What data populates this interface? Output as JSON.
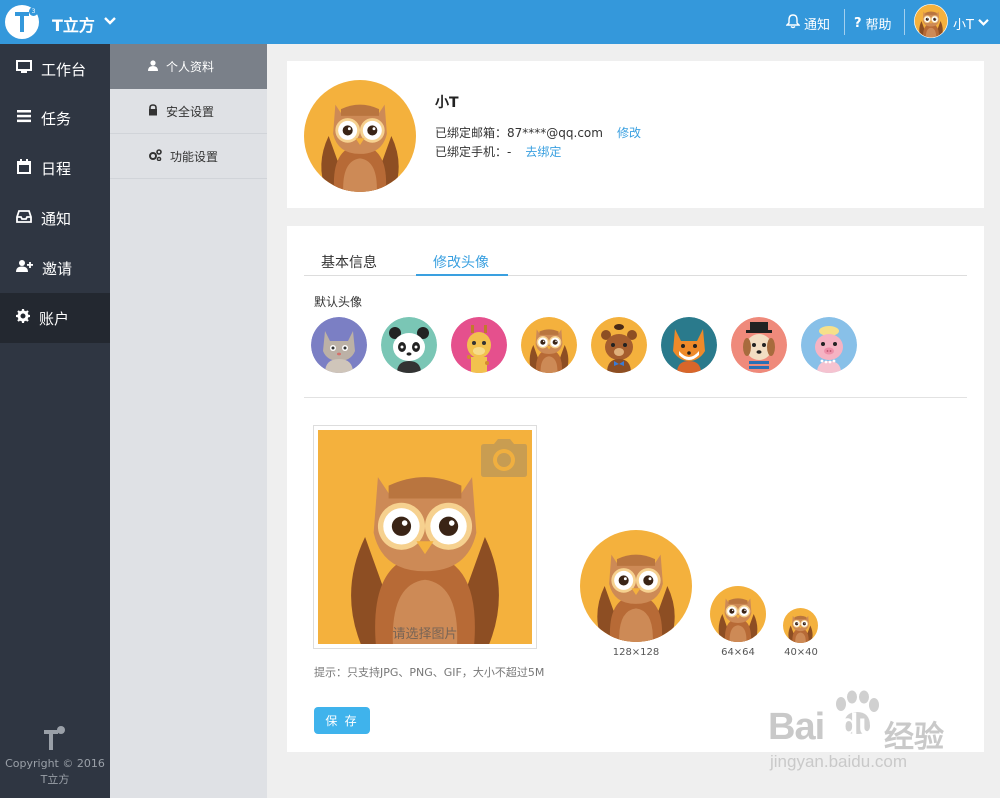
{
  "header": {
    "brand": "T立方",
    "notify_label": "通知",
    "help_label": "帮助",
    "user_name": "小T"
  },
  "sidebar": {
    "items": [
      {
        "label": "工作台",
        "icon": "monitor-icon"
      },
      {
        "label": "任务",
        "icon": "tasks-icon"
      },
      {
        "label": "日程",
        "icon": "calendar-icon"
      },
      {
        "label": "通知",
        "icon": "inbox-icon"
      },
      {
        "label": "邀请",
        "icon": "user-add-icon"
      },
      {
        "label": "账户",
        "icon": "gear-icon"
      }
    ],
    "copyright": "Copyright © 2016",
    "copyright_brand": "T立方"
  },
  "subnav": {
    "items": [
      {
        "label": "个人资料",
        "icon": "user-icon"
      },
      {
        "label": "安全设置",
        "icon": "lock-icon"
      },
      {
        "label": "功能设置",
        "icon": "gears-icon"
      }
    ]
  },
  "profile": {
    "name": "小T",
    "email_label": "已绑定邮箱：",
    "email_value": "87****@qq.com",
    "email_action": "修改",
    "phone_label": "已绑定手机：",
    "phone_value": "-",
    "phone_action": "去绑定"
  },
  "tabs": {
    "items": [
      "基本信息",
      "修改头像"
    ],
    "active": "修改头像"
  },
  "avatar_section": {
    "default_label": "默认头像",
    "avatars": [
      "cat",
      "panda",
      "giraffe",
      "owl",
      "bear",
      "fox",
      "dog",
      "pig"
    ],
    "upload_label": "请选择图片",
    "hint": "提示：只支持JPG、PNG、GIF，大小不超过5M",
    "save_label": "保 存",
    "preview_sizes": [
      "128×128",
      "64×64",
      "40×40"
    ]
  },
  "watermark": {
    "main_a": "Bai",
    "main_b": "du",
    "cn": "经验",
    "url": "jingyan.baidu.com"
  },
  "colors": {
    "header": "#3498db",
    "sidebar": "#2f3642",
    "accent": "#3aa0e0",
    "avatar_bg": "#f4b13d"
  }
}
